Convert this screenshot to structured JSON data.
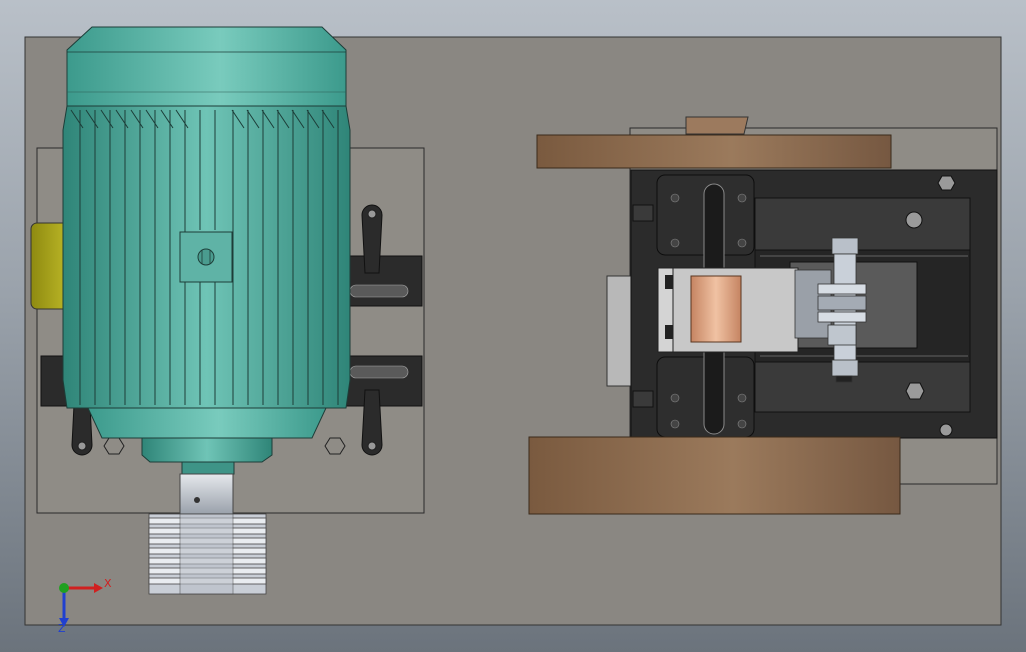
{
  "app": {
    "title": ""
  },
  "viewport": {
    "background_top": "#b9c0c8",
    "background_bottom": "#6b737c",
    "view": "top view"
  },
  "colors": {
    "plate": "#8a8782",
    "motor_teal": "#4ea89a",
    "motor_teal_light": "#6cc2b5",
    "terminal_yellow": "#a9a51c",
    "pulley_silver": "#c9ced6",
    "belt_brown": "#8a6a4e",
    "frame_black": "#2a2a2a",
    "bracket_dark": "#3a3a3a",
    "copper": "#d8a07c"
  },
  "triad": {
    "x_label": "X",
    "z_label": "Z",
    "x_color": "#d02020",
    "z_color": "#2040d0",
    "y_color": "#20a020"
  },
  "components": {
    "motor": "electric-motor",
    "pulley": "v-belt-pulley",
    "terminal_box": "terminal-box",
    "mechanism": "drive-mechanism",
    "belts": "belts"
  }
}
